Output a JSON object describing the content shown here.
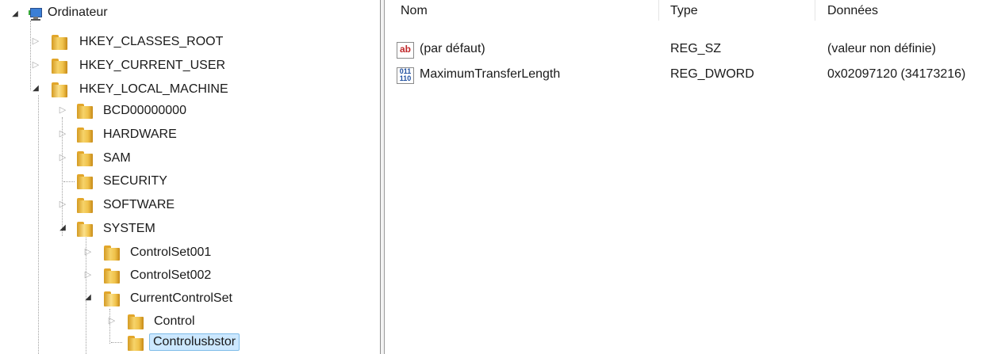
{
  "tree": {
    "root": {
      "label": "Ordinateur",
      "icon": "computer-icon"
    },
    "hives": [
      {
        "label": "HKEY_CLASSES_ROOT",
        "state": "collapsed"
      },
      {
        "label": "HKEY_CURRENT_USER",
        "state": "collapsed"
      },
      {
        "label": "HKEY_LOCAL_MACHINE",
        "state": "expanded"
      }
    ],
    "hklm_children": [
      {
        "label": "BCD00000000",
        "state": "collapsed"
      },
      {
        "label": "HARDWARE",
        "state": "collapsed"
      },
      {
        "label": "SAM",
        "state": "collapsed"
      },
      {
        "label": "SECURITY",
        "state": "leaf"
      },
      {
        "label": "SOFTWARE",
        "state": "collapsed"
      },
      {
        "label": "SYSTEM",
        "state": "expanded"
      }
    ],
    "system_children": [
      {
        "label": "ControlSet001",
        "state": "collapsed"
      },
      {
        "label": "ControlSet002",
        "state": "collapsed"
      },
      {
        "label": "CurrentControlSet",
        "state": "expanded"
      }
    ],
    "ccs_children": [
      {
        "label": "Control",
        "state": "collapsed"
      },
      {
        "label": "Controlusbstor",
        "state": "selected"
      }
    ]
  },
  "values_list": {
    "columns": {
      "name": "Nom",
      "type": "Type",
      "data": "Données"
    },
    "rows": [
      {
        "icon": "string-value-icon",
        "icon_text": "ab",
        "name": "(par défaut)",
        "type": "REG_SZ",
        "data": "(valeur non définie)"
      },
      {
        "icon": "binary-value-icon",
        "icon_text": "011\n110",
        "name": "MaximumTransferLength",
        "type": "REG_DWORD",
        "data": "0x02097120 (34173216)"
      }
    ]
  },
  "colors": {
    "folder": "#f0c24a",
    "selection": "#cce8ff",
    "string_icon": "#c0282a",
    "dword_icon": "#2050a0"
  }
}
